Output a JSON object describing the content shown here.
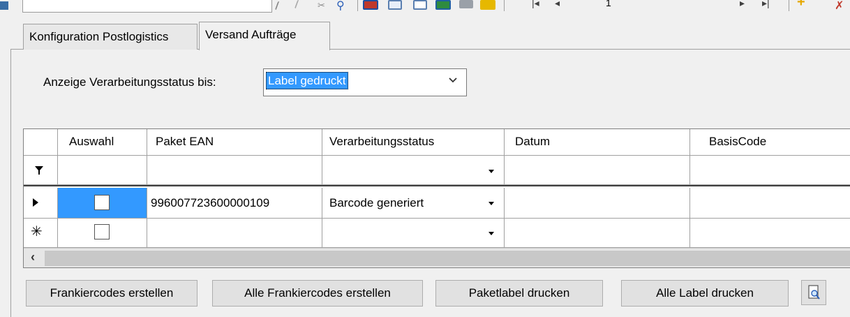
{
  "tabs": [
    "Konfiguration Postlogistics",
    "Versand Aufträge"
  ],
  "toolbar": {
    "page_number": "1"
  },
  "filter": {
    "label": "Anzeige Verarbeitungsstatus bis:",
    "selected": "Label gedruckt"
  },
  "grid": {
    "columns": [
      "Auswahl",
      "Paket EAN",
      "Verarbeitungsstatus",
      "Datum",
      "BasisCode"
    ],
    "rows": [
      {
        "auswahl": false,
        "paket_ean": "996007723600000109",
        "status": "Barcode generiert",
        "datum": "",
        "basiscode": ""
      }
    ]
  },
  "buttons": {
    "create_codes": "Frankiercodes erstellen",
    "create_all_codes": "Alle Frankiercodes erstellen",
    "print_label": "Paketlabel drucken",
    "print_all_labels": "Alle Label drucken"
  },
  "icons": {
    "print_preview": "print-preview-icon",
    "filter": "filter-icon",
    "current_row": "current-row-icon",
    "new_row": "new-row-icon"
  }
}
